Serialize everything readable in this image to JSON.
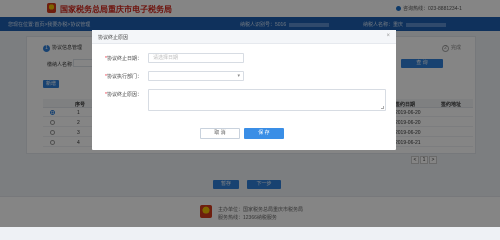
{
  "header": {
    "title": "国家税务总局重庆市电子税务局",
    "hotline": "咨询热线：023-8881234-1"
  },
  "navbar": {
    "breadcrumb": "您现在位置:首页>我要办税>协议管理",
    "user_label": "纳税人识别号：5016",
    "name_label": "纳税人名称：重庆"
  },
  "page": {
    "step1_num": "1",
    "step1_label": "协议信息管理",
    "step2_num": "2",
    "step2_label": "完成",
    "filter_label": "缴纳人名称：",
    "query_button": "查 询",
    "add_button": "新增",
    "table": {
      "columns": [
        "序号",
        "协议",
        "",
        "",
        "",
        "",
        "",
        "签约日期",
        "签约地址"
      ],
      "rows": [
        {
          "no": "1",
          "code": "KS",
          "date": "2019-06-20",
          "addr": "..."
        },
        {
          "no": "2",
          "code": "KS",
          "date": "2019-06-20",
          "addr": "..."
        },
        {
          "no": "3",
          "code": "KS",
          "date": "2019-06-20",
          "addr": "..."
        },
        {
          "no": "4",
          "code": "KS",
          "date": "2019-06-21",
          "addr": "..."
        }
      ]
    },
    "pager": [
      "<",
      "1",
      ">"
    ],
    "prev_button": "暂存",
    "next_button": "下一步"
  },
  "footer": {
    "line1": "主办单位：国家税务总局重庆市税务局",
    "line2": "服务热线：12366纳税服务"
  },
  "modal": {
    "title": "协议终止原因",
    "close_icon": "×",
    "fields": {
      "date_label": "协议终止日期：",
      "date_placeholder": "请选择日期",
      "org_label": "协议执行部门：",
      "reason_label": "协议终止原因："
    },
    "cancel_button": "取 消",
    "save_button": "保 存"
  },
  "colors": {
    "brand_red": "#d4281c",
    "nav_blue": "#1d5fb0",
    "primary_blue": "#3a8ee6"
  }
}
